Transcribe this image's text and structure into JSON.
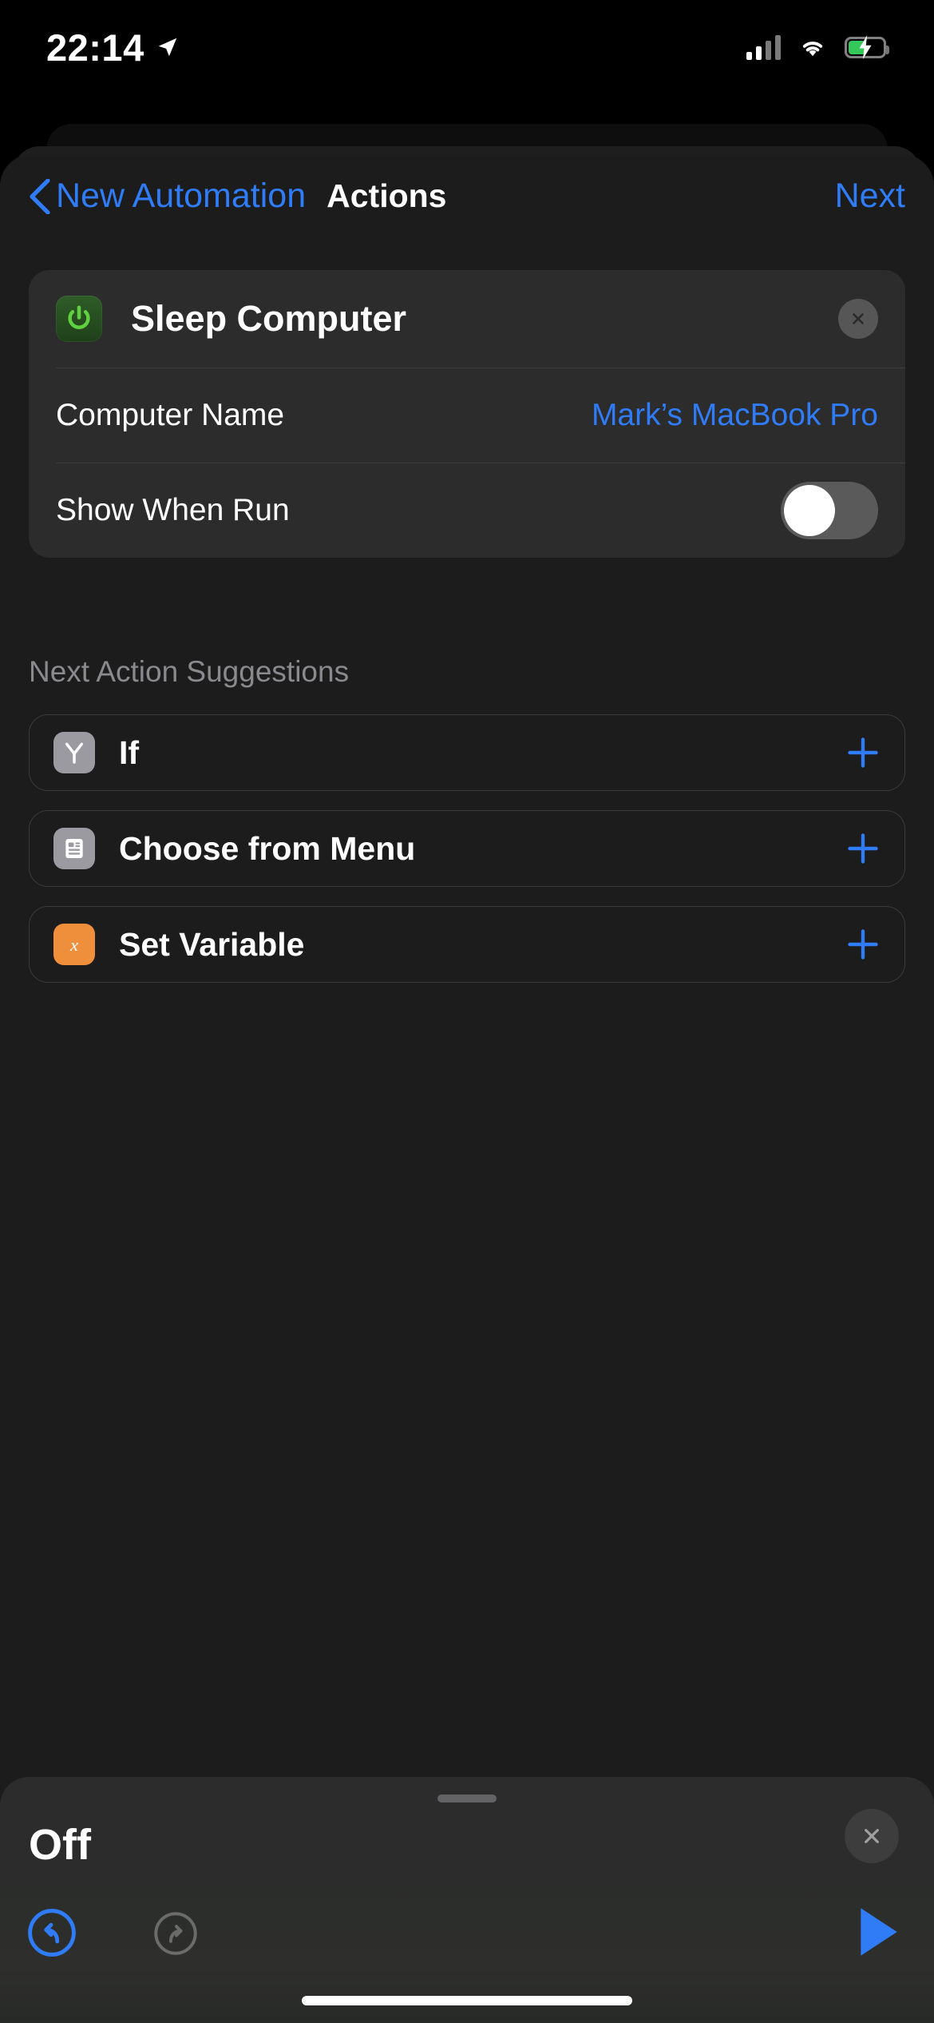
{
  "status_bar": {
    "time": "22:14",
    "location_icon": "location-arrow-icon",
    "cellular_icon": "cellular-signal-icon",
    "wifi_icon": "wifi-icon",
    "battery_icon": "battery-charging-icon"
  },
  "nav": {
    "back_label": "New Automation",
    "back_icon": "chevron-left-icon",
    "title": "Actions",
    "next_label": "Next"
  },
  "action_card": {
    "icon": "power-icon",
    "icon_color": "#5fd040",
    "title": "Sleep Computer",
    "close_icon": "close-circle-icon",
    "rows": [
      {
        "label": "Computer Name",
        "value": "Mark’s MacBook Pro",
        "type": "value"
      },
      {
        "label": "Show When Run",
        "value": "off",
        "type": "toggle"
      }
    ]
  },
  "suggestions": {
    "title": "Next Action Suggestions",
    "items": [
      {
        "label": "If",
        "icon": "branch-icon",
        "icon_style": "gray",
        "add_icon": "plus-icon"
      },
      {
        "label": "Choose from Menu",
        "icon": "menu-list-icon",
        "icon_style": "gray",
        "add_icon": "plus-icon"
      },
      {
        "label": "Set Variable",
        "icon": "variable-x-icon",
        "icon_style": "orange",
        "add_icon": "plus-icon"
      }
    ]
  },
  "bottom_sheet": {
    "grabber": "drag-handle",
    "title": "Off",
    "close_icon": "close-icon"
  },
  "toolbar": {
    "undo_icon": "undo-icon",
    "redo_icon": "redo-icon",
    "play_icon": "play-icon"
  },
  "colors": {
    "accent_blue": "#2f7cf6",
    "page_bg": "#1c1c1c",
    "card_bg": "#2c2c2c",
    "secondary_text": "#8a8a8e",
    "orange": "#ef8f3c",
    "green": "#34c759"
  }
}
